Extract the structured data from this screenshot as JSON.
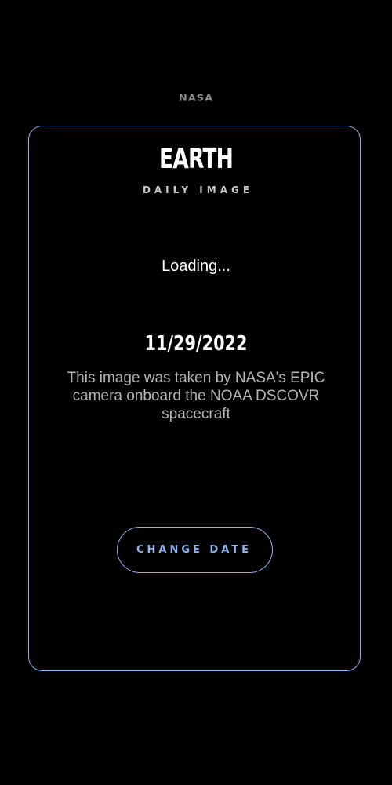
{
  "header": {
    "logo_text": "NASA"
  },
  "card": {
    "title": "EARTH",
    "subtitle": "DAILY IMAGE",
    "loading_text": "Loading...",
    "date": "11/29/2022",
    "description": "This image was taken by NASA's EPIC camera onboard the NOAA DSCOVR spacecraft",
    "button_label": "CHANGE DATE"
  },
  "colors": {
    "background": "#000000",
    "accent": "#8db4ee",
    "text_primary": "#ffffff",
    "text_secondary": "#b5b5b5"
  }
}
